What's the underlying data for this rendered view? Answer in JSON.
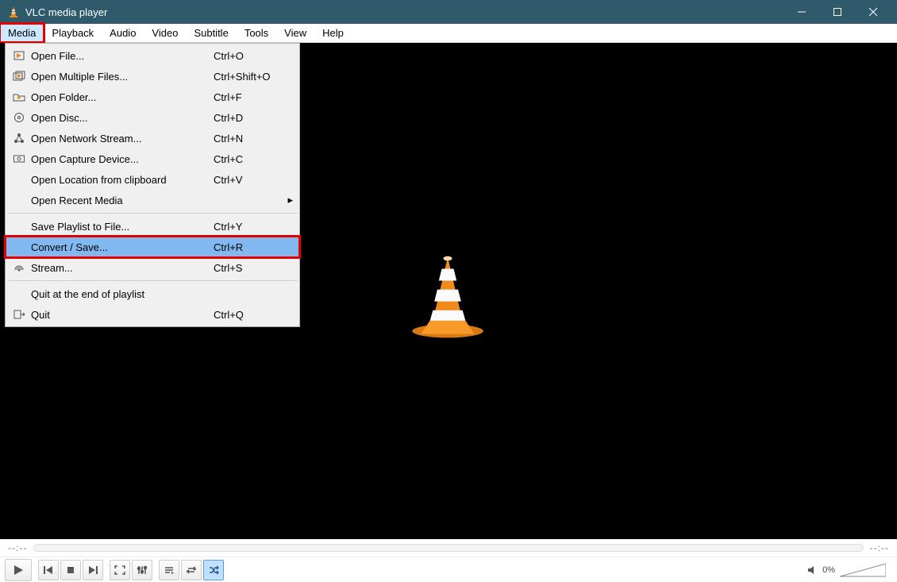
{
  "titlebar": {
    "title": "VLC media player"
  },
  "menubar": {
    "items": [
      "Media",
      "Playback",
      "Audio",
      "Video",
      "Subtitle",
      "Tools",
      "View",
      "Help"
    ],
    "active_index": 0
  },
  "dropdown": {
    "items": [
      {
        "icon": "file",
        "label": "Open File...",
        "accel": "Ctrl+O"
      },
      {
        "icon": "files",
        "label": "Open Multiple Files...",
        "accel": "Ctrl+Shift+O"
      },
      {
        "icon": "folder",
        "label": "Open Folder...",
        "accel": "Ctrl+F"
      },
      {
        "icon": "disc",
        "label": "Open Disc...",
        "accel": "Ctrl+D"
      },
      {
        "icon": "network",
        "label": "Open Network Stream...",
        "accel": "Ctrl+N"
      },
      {
        "icon": "capture",
        "label": "Open Capture Device...",
        "accel": "Ctrl+C"
      },
      {
        "icon": "",
        "label": "Open Location from clipboard",
        "accel": "Ctrl+V"
      },
      {
        "icon": "",
        "label": "Open Recent Media",
        "accel": "",
        "submenu": true
      },
      {
        "sep": true
      },
      {
        "icon": "",
        "label": "Save Playlist to File...",
        "accel": "Ctrl+Y"
      },
      {
        "icon": "",
        "label": "Convert / Save...",
        "accel": "Ctrl+R",
        "highlighted": true
      },
      {
        "icon": "stream",
        "label": "Stream...",
        "accel": "Ctrl+S"
      },
      {
        "sep": true
      },
      {
        "icon": "",
        "label": "Quit at the end of playlist",
        "accel": ""
      },
      {
        "icon": "quit",
        "label": "Quit",
        "accel": "Ctrl+Q"
      }
    ]
  },
  "seek": {
    "left": "--:--",
    "right": "--:--"
  },
  "volume": {
    "percent": "0%"
  },
  "controls": {
    "play": "play",
    "group_nav": [
      "prev",
      "stop",
      "next"
    ],
    "group_view": [
      "fullscreen",
      "ext"
    ],
    "group_playlist": [
      "playlist",
      "loop",
      "shuffle"
    ],
    "shuffle_active": true
  }
}
